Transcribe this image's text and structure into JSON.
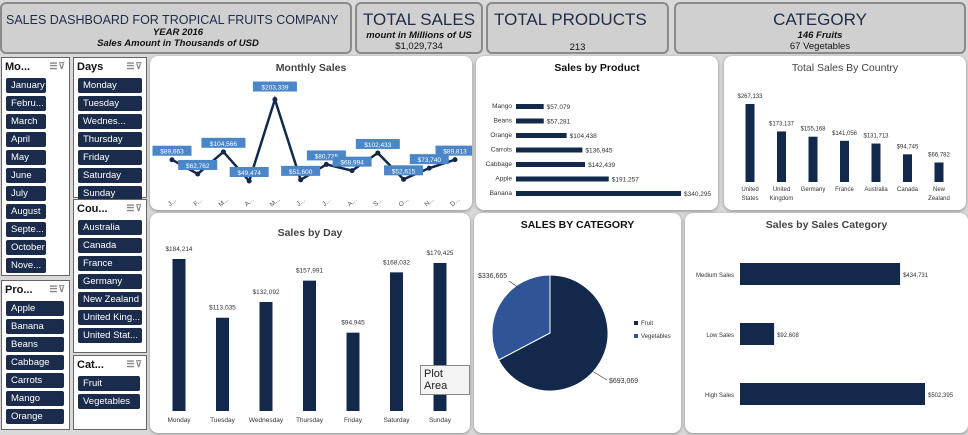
{
  "header": {
    "title": "SALES DASHBOARD FOR TROPICAL FRUITS COMPANY",
    "year": "YEAR 2016",
    "subtitle": "Sales Amount in Thousands of USD",
    "total_sales_label": "TOTAL SALES",
    "total_sales_note": "mount in Millions of US",
    "total_sales_value": "$1,029,734",
    "total_products_label": "TOTAL PRODUCTS",
    "total_products_value": "213",
    "category_label": "CATEGORY",
    "category_fruits": "146 Fruits",
    "category_veg": "67 Vegetables"
  },
  "slicers": {
    "months": {
      "title": "Mo...",
      "items": [
        "January",
        "Febru...",
        "March",
        "April",
        "May",
        "June",
        "July",
        "August",
        "Septe...",
        "October",
        "Nove..."
      ]
    },
    "days": {
      "title": "Days",
      "items": [
        "Monday",
        "Tuesday",
        "Wednes...",
        "Thursday",
        "Friday",
        "Saturday",
        "Sunday"
      ]
    },
    "country": {
      "title": "Cou...",
      "items": [
        "Australia",
        "Canada",
        "France",
        "Germany",
        "New Zealand",
        "United King...",
        "United Stat..."
      ]
    },
    "products": {
      "title": "Pro...",
      "items": [
        "Apple",
        "Banana",
        "Beans",
        "Cabbage",
        "Carrots",
        "Mango",
        "Orange"
      ]
    },
    "category": {
      "title": "Cat...",
      "items": [
        "Fruit",
        "Vegetables"
      ]
    }
  },
  "tooltip": "Plot Area",
  "colors": {
    "navy": "#13294b",
    "line_label": "#4a86c8",
    "veg": "#2f5597"
  },
  "chart_data": [
    {
      "id": "monthly",
      "type": "line",
      "title": "Monthly Sales",
      "categories": [
        "J...",
        "F...",
        "M...",
        "A...",
        "M...",
        "J...",
        "J...",
        "A...",
        "S...",
        "O...",
        "N...",
        "D..."
      ],
      "values": [
        89663,
        62762,
        104566,
        49474,
        203339,
        51600,
        80735,
        68994,
        102433,
        52615,
        73740,
        89813
      ],
      "labels": [
        "$89,663",
        "$62,762",
        "$104,566",
        "$49,474",
        "$203,339",
        "$51,600",
        "$80,735",
        "$68,994",
        "$102,433",
        "$52,615",
        "$73,740",
        "$89,813"
      ]
    },
    {
      "id": "product",
      "type": "bar",
      "title": "Sales by Product",
      "categories": [
        "Mango",
        "Beans",
        "Orange",
        "Carrots",
        "Cabbage",
        "Apple",
        "Banana"
      ],
      "values": [
        57079,
        57281,
        104438,
        136945,
        142439,
        191257,
        340295
      ],
      "labels": [
        "$57,079",
        "$57,281",
        "$104,438",
        "$136,945",
        "$142,439",
        "$191,257",
        "$340,295"
      ]
    },
    {
      "id": "country",
      "type": "bar",
      "title": "Total Sales By Country",
      "categories": [
        "United States",
        "United Kingdom",
        "Germany",
        "France",
        "Australia",
        "Canada",
        "New Zealand"
      ],
      "values": [
        267133,
        173137,
        155168,
        141056,
        131713,
        94745,
        66782
      ],
      "labels": [
        "$267,133",
        "$173,137",
        "$155,168",
        "$141,056",
        "$131,713",
        "$94,745",
        "$66,782"
      ]
    },
    {
      "id": "day",
      "type": "bar",
      "title": "Sales by Day",
      "categories": [
        "Monday",
        "Tuesday",
        "Wednesday",
        "Thursday",
        "Friday",
        "Saturday",
        "Sunday"
      ],
      "values": [
        184214,
        113035,
        132092,
        157991,
        94945,
        168032,
        179425
      ],
      "labels": [
        "$184,214",
        "$113,035",
        "$132,092",
        "$157,991",
        "$94,945",
        "$168,032",
        "$179,425"
      ]
    },
    {
      "id": "category",
      "type": "pie",
      "title": "SALES BY CATEGORY",
      "categories": [
        "Fruit",
        "Vegetables"
      ],
      "values": [
        693069,
        336665
      ],
      "labels": [
        "$693,069",
        "$336,665"
      ]
    },
    {
      "id": "salescat",
      "type": "bar",
      "title": "Sales by Sales Category",
      "categories": [
        "Medium Sales",
        "Low Sales",
        "High Sales"
      ],
      "values": [
        434731,
        92608,
        502395
      ],
      "labels": [
        "$434,731",
        "$92,608",
        "$502,395"
      ]
    }
  ]
}
